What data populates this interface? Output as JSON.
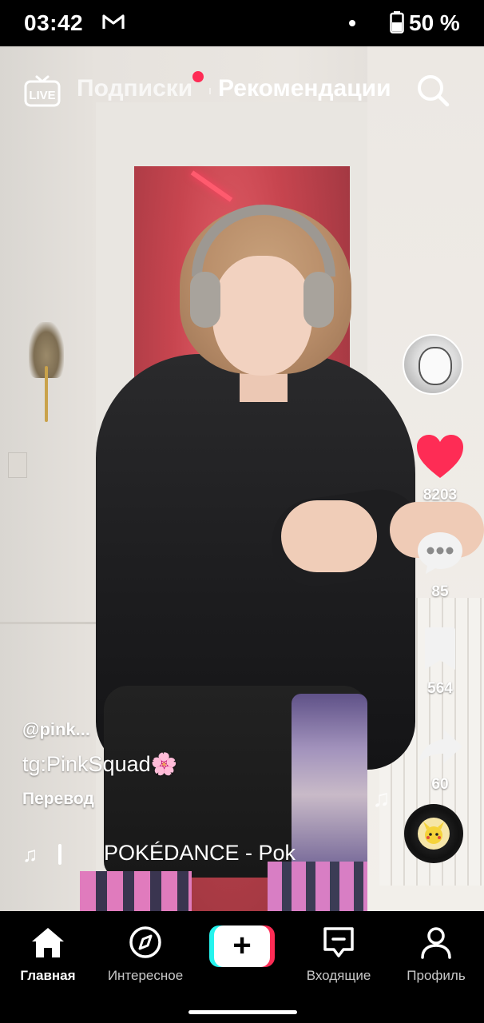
{
  "status_bar": {
    "time": "03:42",
    "mail_icon": "gmail-icon",
    "battery_percent": "50 %"
  },
  "top_nav": {
    "live_label": "LIVE",
    "tab_following": "Подписки",
    "tab_for_you": "Рекомендации",
    "has_notification_dot": true
  },
  "video": {
    "author": "@pink...",
    "description": "tg:PinkSquad🌸",
    "translate_label": "Перевод",
    "music_title": "POKÉDANCE - Pok"
  },
  "side_actions": {
    "likes": "8203",
    "comments": "85",
    "bookmarks": "564",
    "shares": "60",
    "like_color": "#fe2c55"
  },
  "bottom_nav": {
    "items": [
      {
        "label": "Главная",
        "icon": "home-icon",
        "active": true
      },
      {
        "label": "Интересное",
        "icon": "compass-icon",
        "active": false
      },
      {
        "label": "",
        "icon": "plus-icon",
        "active": false
      },
      {
        "label": "Входящие",
        "icon": "inbox-icon",
        "active": false
      },
      {
        "label": "Профиль",
        "icon": "profile-icon",
        "active": false
      }
    ]
  },
  "colors": {
    "accent_pink": "#fe2c55",
    "accent_cyan": "#25f4ee"
  }
}
